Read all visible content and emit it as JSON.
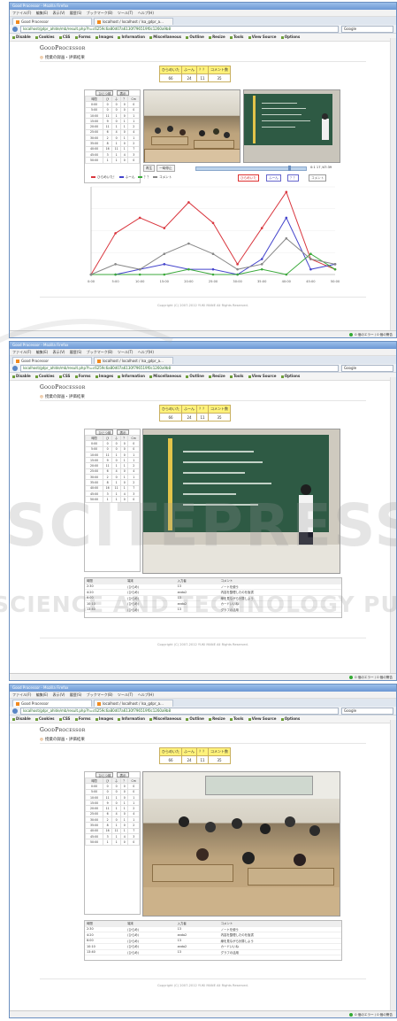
{
  "browser": {
    "title": "Good Processor - Mozilla Firefox",
    "menu": [
      "ファイル(F)",
      "編集(E)",
      "表示(V)",
      "履歴(S)",
      "ブックマーク(B)",
      "ツール(T)",
      "ヘルプ(H)"
    ],
    "tabs": [
      "Good Processor",
      "localhost / localhost / lsa_gdpr_a..."
    ],
    "url": "localhost/gdpr_ahlde/mb/result.php?h=c6259c6a80d07a6130f796519f0c1260a9b8",
    "search_placeholder": "Google",
    "devbar": [
      "Disable",
      "Cookies",
      "CSS",
      "Forms",
      "Images",
      "Information",
      "Miscellaneous",
      "Outline",
      "Resize",
      "Tools",
      "View Source",
      "Options"
    ],
    "status": "0 個のエラー / 0 個の警告"
  },
  "page": {
    "logo": "GoodProcessor",
    "logo_first": "G",
    "logo_rest": "OOD",
    "logo_p": "P",
    "logo_rest2": "ROCESSOR",
    "section_title": "授業の録画・評価結果",
    "copyright": "Copyright (C) 2007-2012 YUKI MANE All Rights Reserved.",
    "stats_headers": [
      "ひらめいた",
      "ふーん",
      "？？",
      "コメント数"
    ],
    "stats_values": [
      "66",
      "24",
      "11",
      "35"
    ],
    "side_buttons": [
      "ひとつ前",
      "表示"
    ],
    "grid_headers": [
      "時間",
      "ひ",
      "ふ",
      "？",
      "Cm"
    ],
    "grid_rows": [
      [
        "0:00",
        "0",
        "0",
        "0",
        "0"
      ],
      [
        "5:00",
        "0",
        "0",
        "0",
        "0"
      ],
      [
        "10:00",
        "11",
        "1",
        "0",
        "1"
      ],
      [
        "15:00",
        "9",
        "0",
        "1",
        "1"
      ],
      [
        "20:00",
        "11",
        "1",
        "1",
        "2"
      ],
      [
        "25:00",
        "6",
        "4",
        "0",
        "4"
      ],
      [
        "30:00",
        "2",
        "0",
        "1",
        "1"
      ],
      [
        "35:00",
        "8",
        "1",
        "0",
        "2"
      ],
      [
        "40:00",
        "16",
        "11",
        "1",
        "7"
      ],
      [
        "45:00",
        "3",
        "1",
        "4",
        "3"
      ],
      [
        "50:00",
        "1",
        "1",
        "0",
        "0"
      ]
    ],
    "player_buttons": [
      "再生",
      "一時停止"
    ],
    "player_time": "0:1 17 /47:39",
    "legend": [
      "ひらめいた！",
      "ふーん",
      "？？",
      "コメント"
    ],
    "legend_buttons": [
      "ひらめいた",
      "ふーん",
      "？？",
      "コメント"
    ],
    "comment_headers": [
      "時間",
      "端末",
      "入力者",
      "コメント"
    ],
    "comment_rows": [
      [
        "2:30",
        "(ひらめ)",
        "13",
        "ノートを使う"
      ],
      [
        "4:20",
        "(ひらめ)",
        "ando2",
        "内容を整理したのを板書"
      ],
      [
        "6:00",
        "(ひらめ)",
        "13",
        "線を見ながら計算しよう"
      ],
      [
        "10:10",
        "(ひらめ)",
        "ando2",
        "カードいいね"
      ],
      [
        "13:40",
        "(ひらめ)",
        "13",
        "グラフの活用"
      ]
    ],
    "watermark_1": "SCITEPRESS",
    "watermark_2": "SCIENCE AND TECHNOLOGY PUBLICATIONS"
  },
  "chart_data": {
    "type": "line",
    "x": [
      "0:00",
      "5:00",
      "10:00",
      "15:00",
      "20:00",
      "25:00",
      "30:00",
      "35:00",
      "40:00",
      "45:00",
      "50:00"
    ],
    "ylim": [
      0,
      17
    ],
    "series": [
      {
        "name": "ひらめいた！",
        "color": "#d9363e",
        "values": [
          0,
          8,
          11,
          9,
          14,
          10,
          2,
          9,
          16,
          3,
          1
        ]
      },
      {
        "name": "ふーん",
        "color": "#4444cc",
        "values": [
          0,
          0,
          1,
          2,
          1,
          1,
          0,
          3,
          11,
          1,
          2
        ]
      },
      {
        "name": "？？",
        "color": "#3caa3c",
        "values": [
          0,
          0,
          0,
          0,
          1,
          0,
          0,
          1,
          0,
          4,
          1
        ]
      },
      {
        "name": "コメント",
        "color": "#888888",
        "values": [
          0,
          2,
          1,
          4,
          6,
          4,
          1,
          2,
          7,
          3,
          2
        ]
      }
    ],
    "xlabel": "",
    "ylabel": "",
    "grid": true,
    "legend": "top"
  }
}
